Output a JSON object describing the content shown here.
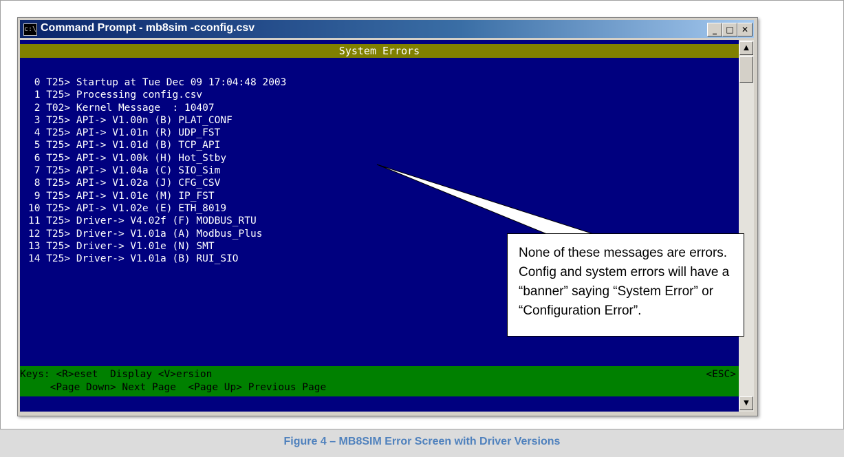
{
  "window": {
    "title": "Command Prompt - mb8sim -cconfig.csv",
    "icon_text": "c:\\",
    "minimize_label": "_",
    "maximize_label": "□",
    "close_label": "✕"
  },
  "console": {
    "header": "System Errors",
    "lines": [
      " 0 T25> Startup at Tue Dec 09 17:04:48 2003",
      " 1 T25> Processing config.csv",
      " 2 T02> Kernel Message  : 10407",
      " 3 T25> API-> V1.00n (B) PLAT_CONF",
      " 4 T25> API-> V1.01n (R) UDP_FST",
      " 5 T25> API-> V1.01d (B) TCP_API",
      " 6 T25> API-> V1.00k (H) Hot_Stby",
      " 7 T25> API-> V1.04a (C) SIO_Sim",
      " 8 T25> API-> V1.02a (J) CFG_CSV",
      " 9 T25> API-> V1.01e (M) IP_FST",
      "10 T25> API-> V1.02e (E) ETH_8019",
      "11 T25> Driver-> V4.02f (F) MODBUS_RTU",
      "12 T25> Driver-> V1.01a (A) Modbus_Plus",
      "13 T25> Driver-> V1.01e (N) SMT",
      "14 T25> Driver-> V1.01a (B) RUI_SIO"
    ],
    "keys_line1": "Keys: <R>eset  Display <V>ersion",
    "keys_esc": "<ESC>",
    "keys_line2": "     <Page Down> Next Page  <Page Up> Previous Page"
  },
  "scrollbar": {
    "up_icon": "scroll-up-arrow-icon",
    "down_icon": "scroll-down-arrow-icon",
    "up_glyph": "▲",
    "down_glyph": "▼"
  },
  "callout": {
    "text": "None of these messages are errors. Config and system errors will have a “banner” saying “System Error” or “Configuration Error”."
  },
  "figure": {
    "caption": "Figure 4 – MB8SIM Error Screen with Driver Versions"
  },
  "colors": {
    "console_bg": "#00007f",
    "header_bar": "#808000",
    "keys_bar": "#008000",
    "caption_text": "#4f81bd"
  }
}
